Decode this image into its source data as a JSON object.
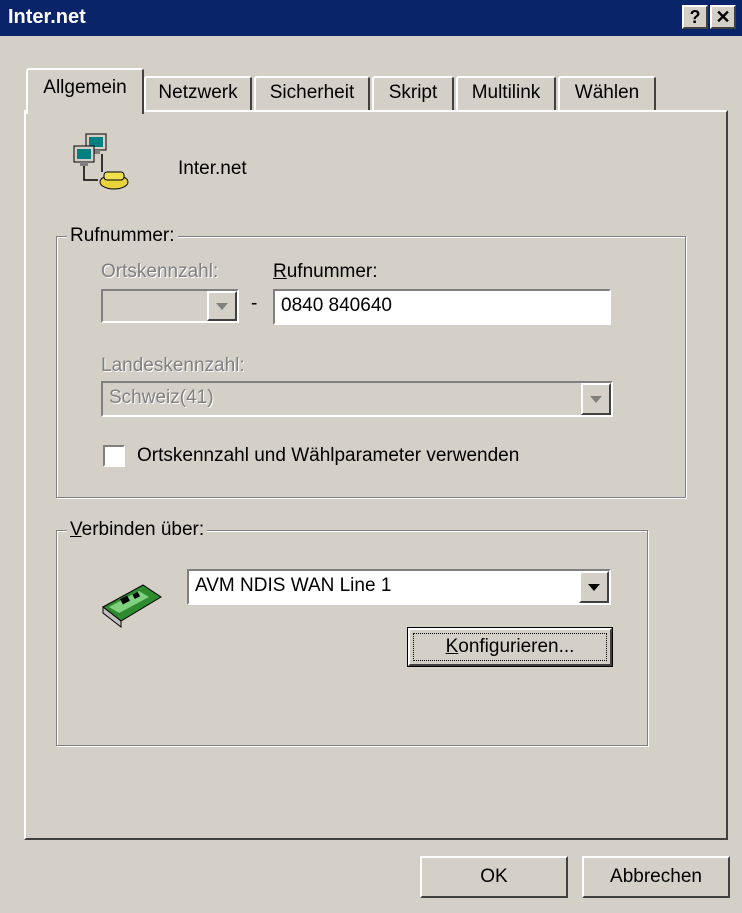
{
  "window": {
    "title": "Inter.net",
    "help_label": "?",
    "close_label": "✕"
  },
  "tabs": [
    {
      "label": "Allgemein",
      "active": true
    },
    {
      "label": "Netzwerk"
    },
    {
      "label": "Sicherheit"
    },
    {
      "label": "Skript"
    },
    {
      "label": "Multilink"
    },
    {
      "label": "Wählen"
    }
  ],
  "connection": {
    "name": "Inter.net",
    "icon": "dialup-network-icon"
  },
  "phone_group": {
    "label": "Rufnummer:",
    "area_code_label": "Ortskennzahl:",
    "area_code_value": "",
    "separator": "-",
    "number_label": "Rufnummer:",
    "number_value": "0840 840640",
    "country_label": "Landeskennzahl:",
    "country_value": "Schweiz(41)",
    "checkbox_label": "Ortskennzahl und Wählparameter verwenden",
    "checkbox_checked": false
  },
  "connect_group": {
    "label": "Verbinden über:",
    "device_icon": "network-card-icon",
    "device_value": "AVM NDIS WAN Line 1",
    "configure_label": "Konfigurieren..."
  },
  "buttons": {
    "ok": "OK",
    "cancel": "Abbrechen"
  }
}
